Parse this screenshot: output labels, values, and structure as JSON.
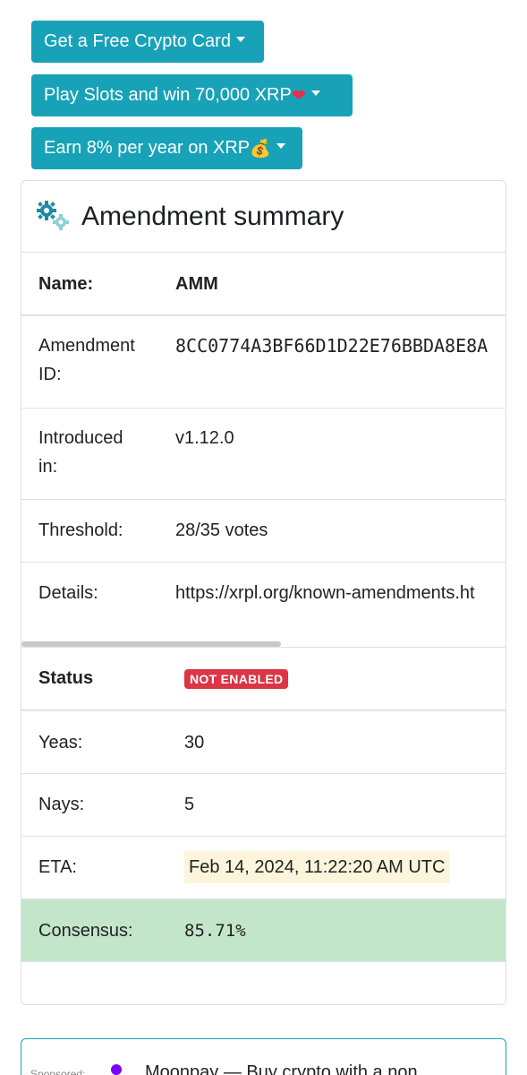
{
  "promos": [
    {
      "label": "Get a Free Crypto Card",
      "emoji": ""
    },
    {
      "label": "Play Slots and win 70,000 XRP",
      "emoji": "❤"
    },
    {
      "label": "Earn 8% per year on XRP",
      "emoji": "💰"
    }
  ],
  "card": {
    "title": "Amendment summary",
    "icon": "gears-icon"
  },
  "rows": {
    "name": {
      "label": "Name:",
      "value": "AMM"
    },
    "amendment_id": {
      "label_line1": "Amendment",
      "label_line2": "ID:",
      "value": "8CC0774A3BF66D1D22E76BBDA8E8A"
    },
    "introduced": {
      "label_line1": "Introduced",
      "label_line2": "in:",
      "value": "v1.12.0"
    },
    "threshold": {
      "label": "Threshold:",
      "value": "28/35 votes"
    },
    "details": {
      "label": "Details:",
      "value": "https://xrpl.org/known-amendments.ht"
    },
    "status": {
      "label": "Status",
      "value": "NOT ENABLED"
    },
    "yeas": {
      "label": "Yeas:",
      "value": "30"
    },
    "nays": {
      "label": "Nays:",
      "value": "5"
    },
    "eta": {
      "label": "ETA:",
      "value": "Feb 14, 2024, 11:22:20 AM UTC"
    },
    "consensus": {
      "label": "Consensus:",
      "value": "85.71%"
    }
  },
  "sponsor": {
    "label": "Sponsored:",
    "text": "Moonpay — Buy crypto with a non"
  },
  "colors": {
    "promo_bg": "#17a2b8",
    "link": "#1a6ea8",
    "badge": "#dc3545",
    "eta_highlight": "#fcf5dc",
    "consensus_bg": "#c3e6cb"
  }
}
